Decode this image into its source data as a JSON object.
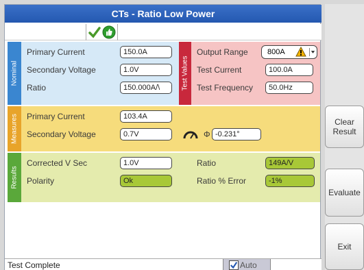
{
  "window": {
    "title": "CTs - Ratio Low Power"
  },
  "nominal": {
    "tab_label": "Nominal",
    "primary_current_label": "Primary Current",
    "primary_current_value": "150.0A",
    "secondary_voltage_label": "Secondary Voltage",
    "secondary_voltage_value": "1.0V",
    "ratio_label": "Ratio",
    "ratio_value": "150.000A/\\"
  },
  "test_values": {
    "tab_label": "Test Values",
    "output_range_label": "Output Range",
    "output_range_value": "800A",
    "test_current_label": "Test Current",
    "test_current_value": "100.0A",
    "test_frequency_label": "Test Frequency",
    "test_frequency_value": "50.0Hz"
  },
  "measures": {
    "tab_label": "Measures",
    "primary_current_label": "Primary Current",
    "primary_current_value": "103.4A",
    "secondary_voltage_label": "Secondary Voltage",
    "secondary_voltage_value": "0.7V",
    "phase_symbol": "Φ",
    "phase_value": "-0.231°"
  },
  "results": {
    "tab_label": "Results",
    "corrected_v_sec_label": "Corrected V Sec",
    "corrected_v_sec_value": "1.0V",
    "polarity_label": "Polarity",
    "polarity_value": "Ok",
    "ratio_label": "Ratio",
    "ratio_value": "149A/V",
    "ratio_error_label": "Ratio % Error",
    "ratio_error_value": "-1%"
  },
  "status": {
    "text": "Test Complete",
    "auto_label": "Auto"
  },
  "side_buttons": {
    "clear_result": "Clear\nResult",
    "evaluate": "Evaluate",
    "exit": "Exit"
  },
  "colors": {
    "title_bar": "#2458b0",
    "nominal": "#d6e9f7",
    "test_values": "#f6c4c4",
    "measures": "#f6dc7c",
    "results": "#e4ebad",
    "result_field": "#a8c837"
  },
  "icons": [
    "check-icon",
    "thumbs-up-icon",
    "warning-icon",
    "dropdown-arrow-icon",
    "gauge-icon",
    "checkbox-icon"
  ]
}
